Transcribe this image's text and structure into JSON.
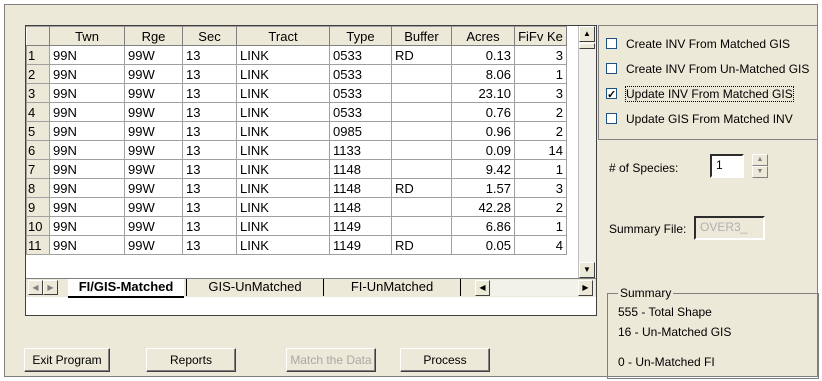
{
  "grid": {
    "columns": [
      "",
      "Twn",
      "Rge",
      "Sec",
      "Tract",
      "Type",
      "Buffer",
      "Acres",
      "FiFv Ke"
    ],
    "rows": [
      [
        "1",
        "99N",
        "99W",
        "13",
        "LINK",
        "0533",
        "RD",
        "0.13",
        "3"
      ],
      [
        "2",
        "99N",
        "99W",
        "13",
        "LINK",
        "0533",
        "",
        "8.06",
        "1"
      ],
      [
        "3",
        "99N",
        "99W",
        "13",
        "LINK",
        "0533",
        "",
        "23.10",
        "3"
      ],
      [
        "4",
        "99N",
        "99W",
        "13",
        "LINK",
        "0533",
        "",
        "0.76",
        "2"
      ],
      [
        "5",
        "99N",
        "99W",
        "13",
        "LINK",
        "0985",
        "",
        "0.96",
        "2"
      ],
      [
        "6",
        "99N",
        "99W",
        "13",
        "LINK",
        "1133",
        "",
        "0.09",
        "14"
      ],
      [
        "7",
        "99N",
        "99W",
        "13",
        "LINK",
        "1148",
        "",
        "9.42",
        "1"
      ],
      [
        "8",
        "99N",
        "99W",
        "13",
        "LINK",
        "1148",
        "RD",
        "1.57",
        "3"
      ],
      [
        "9",
        "99N",
        "99W",
        "13",
        "LINK",
        "1148",
        "",
        "42.28",
        "2"
      ],
      [
        "10",
        "99N",
        "99W",
        "13",
        "LINK",
        "1149",
        "",
        "6.86",
        "1"
      ],
      [
        "11",
        "99N",
        "99W",
        "13",
        "LINK",
        "1149",
        "RD",
        "0.05",
        "4"
      ]
    ]
  },
  "tabs": {
    "active": "FI/GIS-Matched",
    "second": "GIS-UnMatched",
    "third": "FI-UnMatched"
  },
  "options": {
    "create_matched": "Create INV From Matched GIS",
    "create_unmatched": "Create INV From Un-Matched GIS",
    "update_inv": "Update INV From Matched GIS",
    "update_gis": "Update GIS From Matched INV"
  },
  "species": {
    "label": "# of Species:",
    "value": "1"
  },
  "summary_file": {
    "label": "Summary File:",
    "value": "OVER3_"
  },
  "summary": {
    "legend": "Summary",
    "line1": "555 - Total Shape",
    "line2": "16 - Un-Matched GIS",
    "line3": "0 - Un-Matched FI"
  },
  "buttons": {
    "exit": "Exit Program",
    "reports": "Reports",
    "match": "Match the Data",
    "process": "Process"
  }
}
